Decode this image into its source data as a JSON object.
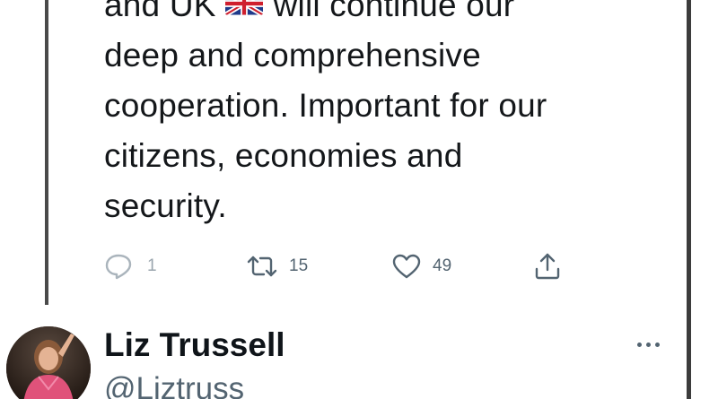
{
  "tweet": {
    "text_lines": [
      {
        "before_flag": "and UK",
        "after_flag": "will continue our"
      },
      "deep and comprehensive",
      "cooperation. Important for our",
      "citizens, economies and",
      "security."
    ],
    "flag_icon": "uk-flag-icon"
  },
  "actions": {
    "reply_count": "1",
    "retweet_count": "15",
    "like_count": "49"
  },
  "author": {
    "display_name": "Liz Trussell",
    "handle": "@Liztruss"
  },
  "colors": {
    "text": "#14171a",
    "muted": "#536471",
    "frame": "#4a4a4a"
  }
}
